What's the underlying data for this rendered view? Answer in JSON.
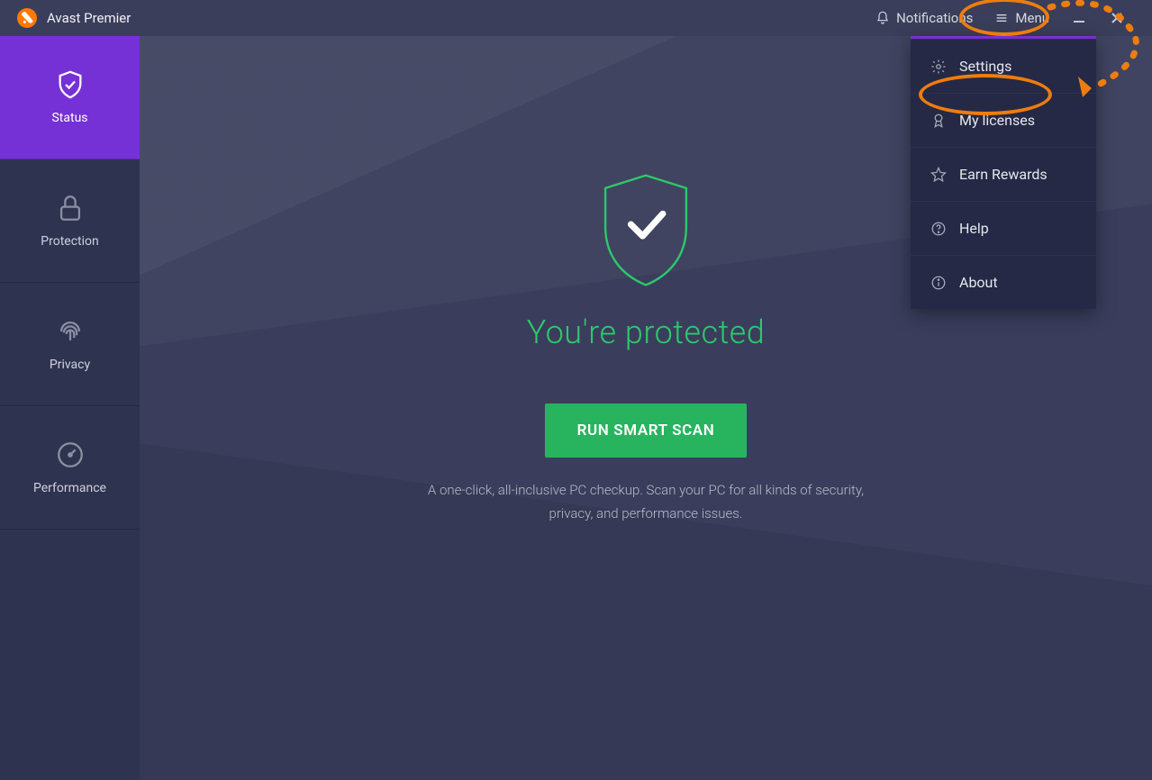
{
  "app": {
    "title": "Avast Premier"
  },
  "titlebar": {
    "notifications": "Notifications",
    "menu": "Menu"
  },
  "sidebar": {
    "items": [
      {
        "label": "Status"
      },
      {
        "label": "Protection"
      },
      {
        "label": "Privacy"
      },
      {
        "label": "Performance"
      }
    ]
  },
  "main": {
    "status_title": "You're protected",
    "scan_button": "RUN SMART SCAN",
    "scan_desc_line1": "A one-click, all-inclusive PC checkup. Scan your PC for all kinds of security,",
    "scan_desc_line2": "privacy, and performance issues."
  },
  "dropdown": {
    "items": [
      {
        "label": "Settings"
      },
      {
        "label": "My licenses"
      },
      {
        "label": "Earn Rewards"
      },
      {
        "label": "Help"
      },
      {
        "label": "About"
      }
    ]
  },
  "colors": {
    "accent": "#7531d6",
    "green": "#28b45f",
    "highlight": "#ed7d0e"
  }
}
